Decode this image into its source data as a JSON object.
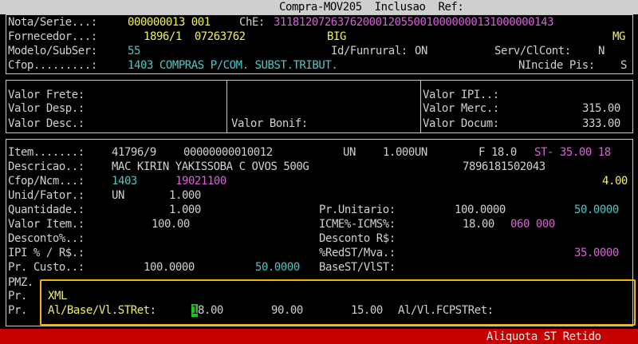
{
  "header": {
    "title": "Compra-MOV205  Inclusao  Ref:"
  },
  "nota": {
    "nota_label": "Nota/Serie...:",
    "nota_value": "000000013 001",
    "che_label": "ChE:",
    "che_value": "31181207263762000120550010000000131000000143",
    "fornecedor_label": "Fornecedor...:",
    "fornecedor_value": "1896/1  07263762",
    "fornecedor_name": "BIG",
    "fornecedor_uf": "MG",
    "modelo_label": "Modelo/SubSer:",
    "modelo_value": "55",
    "funrural_label": "Id/Funrural:",
    "funrural_value": "ON",
    "serv_label": "Serv/ClCont:",
    "serv_value": "N",
    "cfop_label": "Cfop.........:",
    "cfop_value": "1403 COMPRAS P/COM. SUBST.TRIBUT.",
    "nincide_label": "NIncide Pis:",
    "nincide_value": "S"
  },
  "valores": {
    "frete_label": "Valor Frete:",
    "desp_label": "Valor Desp.:",
    "desc_label": "Valor Desc.:",
    "bonif_label": "Valor Bonif:",
    "ipi_label": "Valor IPI..:",
    "merc_label": "Valor Merc.:",
    "merc_value": "315.00",
    "docum_label": "Valor Docum:",
    "docum_value": "333.00"
  },
  "item": {
    "item_label": "Item.......:",
    "item_code": "41796/9",
    "item_ean": "00000000010012",
    "item_un": "UN",
    "item_qty": "1.000UN",
    "item_f": "F 18.0",
    "item_st": "ST- 35.00 18",
    "descricao_label": "Descricao..:",
    "descricao_value": "MAC KIRIN YAKISSOBA C OVOS 500G",
    "descricao_barcode": "7896181502043",
    "ncm_label": "Cfop/Ncm...:",
    "ncm_cfop": "1403",
    "ncm_value": "19021100",
    "ncm_extra": "4.00",
    "unid_label": "Unid/Fator.:",
    "unid_un": "UN",
    "unid_fator": "1.000",
    "qtd_label": "Quantidade.:",
    "qtd_value": "1.000",
    "valor_item_label": "Valor Item.:",
    "valor_item_value": "100.00",
    "desconto_pct_label": "Desconto%..:",
    "ipi_label": "IPI % / R$.:",
    "custo_label": "Pr. Custo..:",
    "custo_value": "100.0000",
    "custo_value2": "50.0000",
    "pmz_label": "PMZ.",
    "pr_label_1": "Pr.",
    "pr_label_2": "Pr.",
    "unitario_label": "Pr.Unitario:",
    "unitario_value": "100.0000",
    "unitario_value2": "50.0000",
    "icme_label": "ICME%-ICMS%:",
    "icme_value": "18.00",
    "icme_value2": "060 000",
    "desconto_rs_label": "Desconto R$:",
    "redst_label": "%RedST/Mva.:",
    "redst_value": "35.0000",
    "basest_label": "BaseST/VlST:"
  },
  "xml": {
    "title": "XML",
    "stret_label": "Al/Base/Vl.STRet:",
    "stret_cursor_char": "1",
    "stret_aliquota_rest": "8.00",
    "stret_base": "90.00",
    "stret_valor": "15.00",
    "fcpst_label": "Al/Vl.FCPSTRet:"
  },
  "status": {
    "message": "Aliquota ST Retido"
  }
}
